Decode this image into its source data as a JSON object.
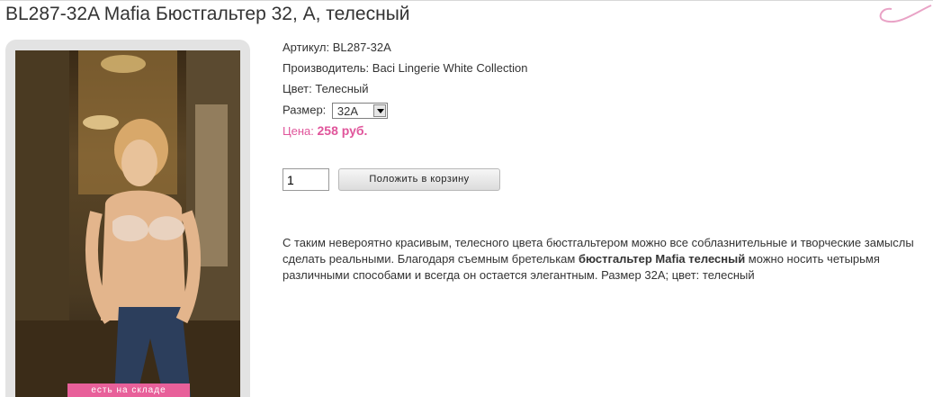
{
  "product": {
    "title": "BL287-32A Mafia Бюстгальтер 32, A, телесный",
    "stock_badge": "есть на складе",
    "article_label": "Артикул:",
    "article_value": "BL287-32A",
    "manufacturer_label": "Производитель:",
    "manufacturer_value": "Baci Lingerie White Collection",
    "color_label": "Цвет:",
    "color_value": "Телесный",
    "size_label": "Размер:",
    "size_value": "32A",
    "price_label": "Цена:",
    "price_value": "258 руб.",
    "quantity": "1",
    "cart_button": "Положить в корзину",
    "description_part1": "С таким невероятно красивым, телесного цвета бюстгальтером можно все соблазнительные и творческие замыслы сделать реальными. Благодаря съемным бретелькам ",
    "description_bold": "бюстгальтер Mafia телесный",
    "description_part2": " можно носить четырьмя различными способами и всегда он остается элегантным. Размер 32А; цвет: телесный"
  },
  "colors": {
    "accent": "#e0559b",
    "badge": "#e8609a"
  }
}
